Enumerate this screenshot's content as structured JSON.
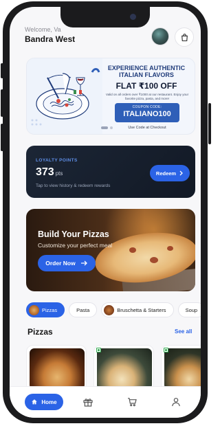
{
  "header": {
    "welcome": "Welcome, Va",
    "location": "Bandra West"
  },
  "promo": {
    "headline": "EXPERIENCE AUTHENTIC ITALIAN FLAVORS",
    "offer": "FLAT ₹100 OFF",
    "details": "Valid on all orders over ₹1000 at our restaurant. Enjoy your favorite pizza, pasta, and more!",
    "coupon_label": "COUPON CODE:",
    "coupon_code": "ITALIANO100",
    "footer": "Use Code at Checkout"
  },
  "loyalty": {
    "title": "LOYALTY POINTS",
    "points": "373",
    "unit": "pts",
    "hint": "Tap to view history & redeem rewards",
    "redeem_label": "Redeem"
  },
  "hero": {
    "title": "Build Your Pizzas",
    "subtitle": "Customize your perfect meal",
    "cta_label": "Order Now"
  },
  "categories": [
    {
      "label": "Pizzas",
      "active": true
    },
    {
      "label": "Pasta",
      "active": false
    },
    {
      "label": "Bruschetta & Starters",
      "active": false
    },
    {
      "label": "Soup",
      "active": false
    }
  ],
  "section": {
    "title": "Pizzas",
    "see_all": "See all"
  },
  "nav": {
    "home_label": "Home",
    "icons": [
      "home-icon",
      "gift-icon",
      "cart-icon",
      "profile-icon"
    ]
  },
  "colors": {
    "accent": "#2b63e6",
    "loyalty_bg": "#1c2636",
    "veg": "#2fa84f"
  }
}
